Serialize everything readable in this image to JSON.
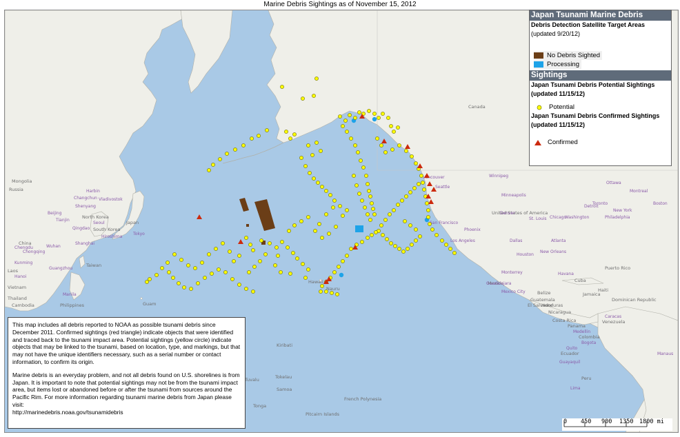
{
  "title": "Marine Debris Sightings as of November 15, 2012",
  "colors": {
    "ocean": "#a9c9e6",
    "land": "#efefe9",
    "potential": "#ffff00",
    "confirmed": "#cc2a0e",
    "no_debris": "#6b3e17",
    "processing": "#1ea3e8",
    "legend_header": "#5f6b7a"
  },
  "legend": {
    "header1": "Japan Tsunami Marine Debris",
    "target_areas_title": "Debris Detection Satellite Target Areas",
    "target_areas_updated": "(updated 9/20/12)",
    "no_debris_label": "No Debris Sighted",
    "processing_label": "Processing",
    "header2": "Sightings",
    "potential_title": "Japan Tsunami Debris Potential Sightings",
    "potential_updated": "(updated 11/15/12)",
    "potential_label": "Potential",
    "confirmed_title": "Japan Tsunami Debris Confirmed Sightings",
    "confirmed_updated": "(updated 11/15/12)",
    "confirmed_label": "Confirmed"
  },
  "note": {
    "paragraph1": "This map includes all debris reported to NOAA as possible tsunami debris since December 2011. Confirmed sightings (red triangle) indicate objects that were identified and traced back to the tsunami impact area. Potential sightings (yellow circle) indicate objects that may be linked to the tsunami, based on location, type, and markings, but that may not have the unique identifiers necessary, such as a serial number or contact information, to confirm its origin.",
    "paragraph2": "Marine debris is an everyday problem, and not all debris found on U.S. shorelines is from Japan. It is important to note that potential sightings may not be from the tsunami impact area, but items lost or abandoned before or after the tsunami from sources around the Pacific Rim. For more information regarding tsunami marine debris from Japan please visit:",
    "url": "http://marinedebris.noaa.gov/tsunamidebris"
  },
  "scale": {
    "ticks": [
      "0",
      "450",
      "900",
      "1350"
    ],
    "end_label": "1800 mi"
  },
  "map_labels": {
    "canada": "Canada",
    "united_states": "United States of America",
    "mexico": "Mexico",
    "hawaii": "Hawaii",
    "guam": "Guam",
    "kiribati": "Kiribati",
    "tokelau": "Tokelau",
    "samoa": "Samoa",
    "french_polynesia": "French Polynesia",
    "pitcairn": "Pitcairn Islands",
    "tuvalu": "Tuvalu",
    "tonga": "Tonga",
    "nauru": "Nauru",
    "venezuela": "Venezuela",
    "colombia": "Colombia",
    "ecuador": "Ecuador",
    "peru": "Peru",
    "guatemala": "Guatemala",
    "nicaragua": "Nicaragua",
    "cuba": "Cuba",
    "haiti": "Haiti",
    "dominican_republic": "Dominican Republic",
    "puerto_rico": "Puerto Rico",
    "jamaica": "Jamaica",
    "honduras": "Honduras",
    "costa_rica": "Costa Rica",
    "panama": "Panama",
    "el_salvador": "El Salvador",
    "belize": "Belize",
    "japan": "Japan",
    "mongolia": "Mongolia",
    "china": "China",
    "taiwan": "Taiwan",
    "vietnam": "Vietnam",
    "laos": "Laos",
    "thailand": "Thailand",
    "cambodia": "Cambodia",
    "philippines": "Philippines",
    "north_korea": "North Korea",
    "south_korea": "South Korea",
    "russia": "Russia",
    "harbin": "Harbin",
    "changchun": "Changchun",
    "shenyang": "Shenyang",
    "beijing": "Beijing",
    "tianjin": "Tianjin",
    "qingdao": "Qingdao",
    "wuhan": "Wuhan",
    "shanghai": "Shanghai",
    "chongqing": "Chongqing",
    "chengdu": "Chengdu",
    "guangzhou": "Guangzhou",
    "kunming": "Kunming",
    "hanoi": "Hanoi",
    "seoul": "Seoul",
    "tokyo": "Tokyo",
    "hiroshima": "Hiroshima",
    "manila": "Manila",
    "vladivostok": "Vladivostok",
    "seattle": "Seattle",
    "san_francisco": "San Francisco",
    "los_angeles": "Los Angeles",
    "phoenix": "Phoenix",
    "chicago": "Chicago",
    "minneapolis": "Minneapolis",
    "winnipeg": "Winnipeg",
    "vancouver": "Vancouver",
    "toronto": "Toronto",
    "montreal": "Montreal",
    "boston": "Boston",
    "new_york": "New York",
    "philadelphia": "Philadelphia",
    "washington": "Washington",
    "st_louis": "St. Louis",
    "denver": "Denver",
    "dallas": "Dallas",
    "houston": "Houston",
    "new_orleans": "New Orleans",
    "atlanta": "Atlanta",
    "detroit": "Detroit",
    "ottawa": "Ottawa",
    "mexico_city": "Mexico City",
    "guadalajara": "Guadalajara",
    "monterrey": "Monterrey",
    "havana": "Havana",
    "bogota": "Bogota",
    "lima": "Lima",
    "quito": "Quito",
    "caracas": "Caracas",
    "medellin": "Medellin",
    "guayaquil": "Guayaquil",
    "manaus": "Manaus"
  }
}
